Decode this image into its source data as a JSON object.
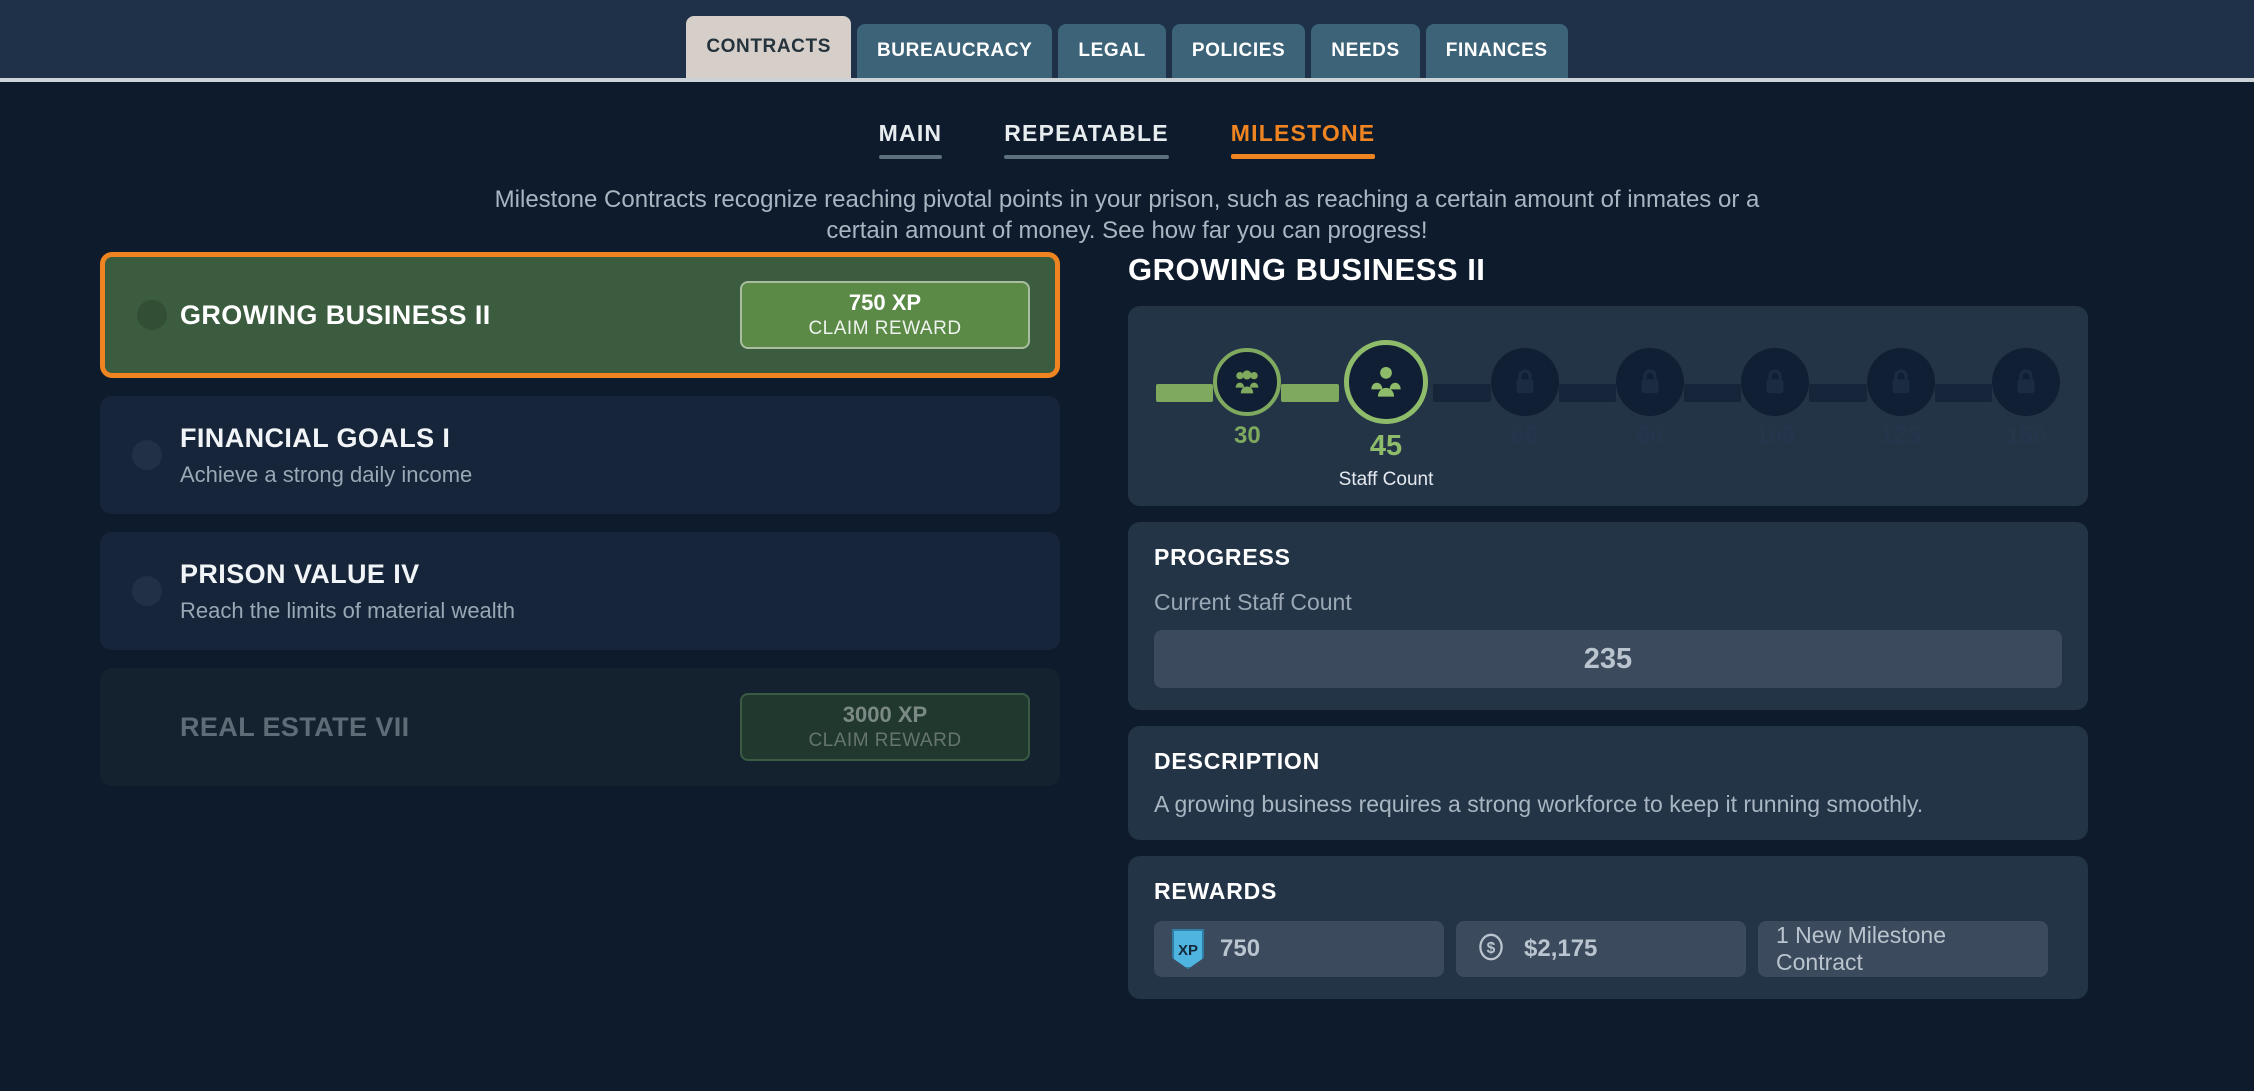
{
  "top_tabs": [
    {
      "label": "CONTRACTS",
      "active": true
    },
    {
      "label": "BUREAUCRACY",
      "active": false
    },
    {
      "label": "LEGAL",
      "active": false
    },
    {
      "label": "POLICIES",
      "active": false
    },
    {
      "label": "NEEDS",
      "active": false
    },
    {
      "label": "FINANCES",
      "active": false
    }
  ],
  "sub_tabs": [
    {
      "label": "MAIN",
      "active": false
    },
    {
      "label": "REPEATABLE",
      "active": false
    },
    {
      "label": "MILESTONE",
      "active": true
    }
  ],
  "intro": "Milestone Contracts recognize reaching pivotal points in your prison, such as reaching a certain amount of inmates or a certain amount of money. See how far you can progress!",
  "contracts": [
    {
      "title": "GROWING BUSINESS II",
      "subtitle": "",
      "selected": true,
      "dimmed": false,
      "claim": {
        "amount": "750 XP",
        "label": "CLAIM REWARD",
        "enabled": true
      }
    },
    {
      "title": "FINANCIAL GOALS I",
      "subtitle": "Achieve a strong daily income",
      "selected": false,
      "dimmed": false,
      "claim": null
    },
    {
      "title": "PRISON VALUE IV",
      "subtitle": "Reach the limits of material wealth",
      "selected": false,
      "dimmed": false,
      "claim": null
    },
    {
      "title": "REAL ESTATE VII",
      "subtitle": "",
      "selected": false,
      "dimmed": true,
      "claim": {
        "amount": "3000 XP",
        "label": "CLAIM REWARD",
        "enabled": false
      }
    }
  ],
  "detail": {
    "title": "GROWING BUSINESS II",
    "milestones": [
      {
        "value": "30",
        "state": "done"
      },
      {
        "value": "45",
        "state": "current",
        "caption": "Staff Count"
      },
      {
        "value": "60",
        "state": "locked"
      },
      {
        "value": "80",
        "state": "locked"
      },
      {
        "value": "100",
        "state": "locked"
      },
      {
        "value": "125",
        "state": "locked"
      },
      {
        "value": "150",
        "state": "locked"
      }
    ],
    "progress": {
      "heading": "PROGRESS",
      "label": "Current Staff Count",
      "value": "235"
    },
    "description": {
      "heading": "DESCRIPTION",
      "text": "A growing business requires a strong workforce to keep it running smoothly."
    },
    "rewards": {
      "heading": "REWARDS",
      "items": [
        {
          "icon": "xp-badge-icon",
          "badge_text": "XP",
          "value": "750"
        },
        {
          "icon": "money-icon",
          "value": "$2,175"
        },
        {
          "icon": "none",
          "value": "1 New Milestone Contract"
        }
      ]
    }
  },
  "colors": {
    "accent_orange": "#f08421",
    "progress_green": "#7fa95e",
    "page_bg": "#0e1b2c",
    "panel_bg": "#243447",
    "xp_blue": "#4fb4e0"
  }
}
